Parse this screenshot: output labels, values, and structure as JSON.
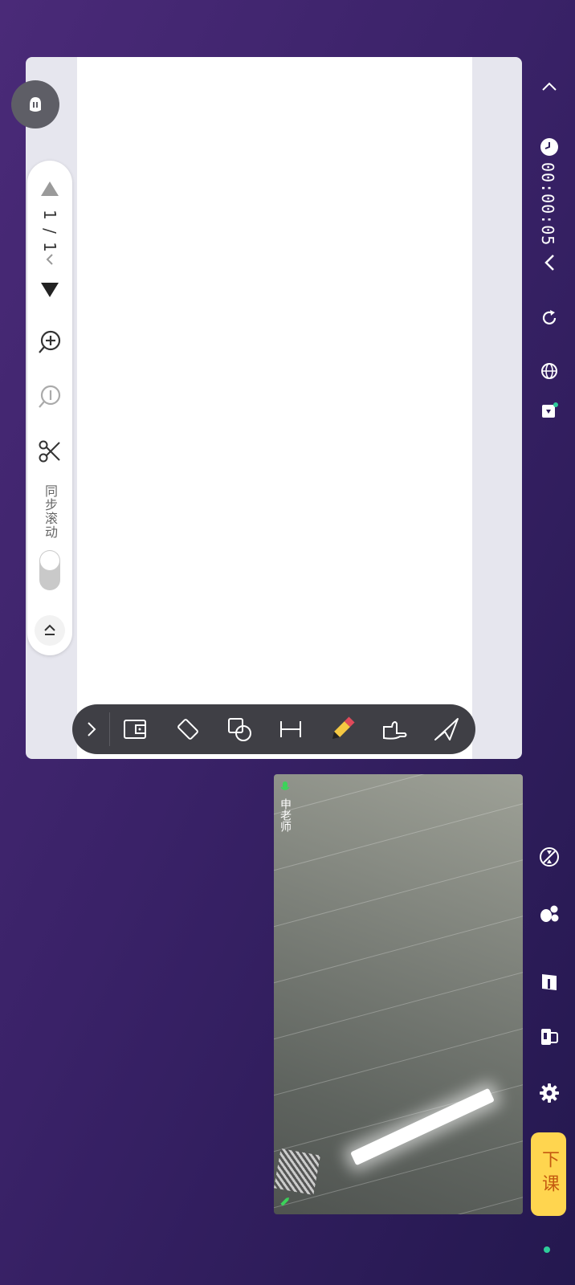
{
  "board": {
    "pager": {
      "page_label": "1 / 1"
    },
    "sync_scroll_label": "同步滚动",
    "sync_scroll_on": false
  },
  "toolbar": {
    "tools": [
      "expand-tool",
      "courseware-tool",
      "eraser-tool",
      "shape-tool",
      "text-tool",
      "pencil-tool",
      "pointer-hand-tool",
      "laser-pointer-tool"
    ],
    "active_tool": "pencil-tool"
  },
  "video": {
    "teacher_name": "申老师"
  },
  "sidebar": {
    "timer": "00:00:05",
    "end_class_label": "下课"
  },
  "colors": {
    "accent_yellow": "#ffd54f",
    "end_class_text": "#c45a10",
    "status_green": "#2ecc9a",
    "mic_green": "#3cd35a"
  }
}
